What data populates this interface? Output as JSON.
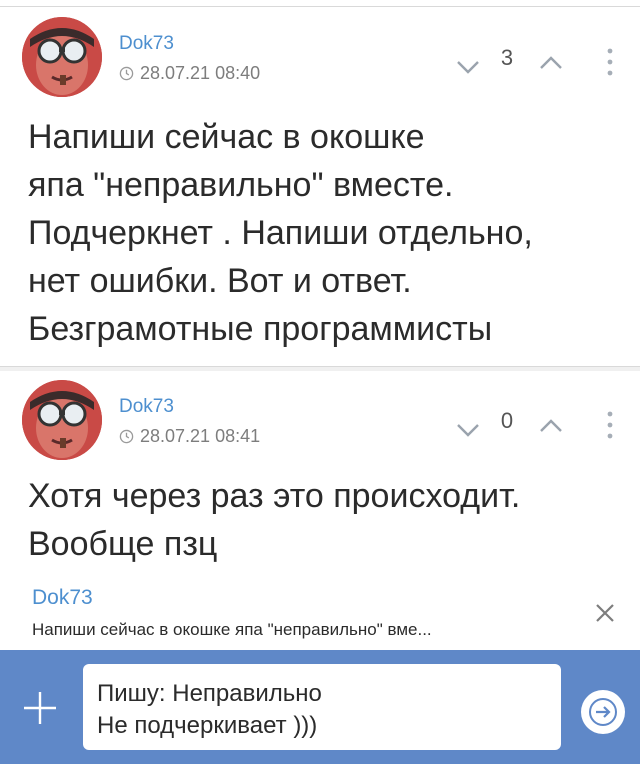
{
  "comments": [
    {
      "author": "Dok73",
      "timestamp": "28.07.21 08:40",
      "score": "3",
      "text": "Напиши сейчас в окошке\nяпа \"неправильно\" вместе.\nПодчеркнет . Напиши отдельно,\nнет ошибки. Вот и ответ.\nБезграмотные программисты"
    },
    {
      "author": "Dok73",
      "timestamp": "28.07.21 08:41",
      "score": "0",
      "text": "Хотя через раз это происходит.\nВообще пзц"
    }
  ],
  "reply_preview": {
    "author": "Dok73",
    "snippet": "Напиши сейчас в окошке япа \"неправильно\" вме..."
  },
  "composer": {
    "line1": "Пишу: Неправильно",
    "line2": "Не подчеркивает )))"
  },
  "colors": {
    "accent": "#4d8fcf",
    "composer_bar": "#5f88c8",
    "text": "#2b2b2b",
    "muted": "#7d7d7d"
  },
  "icons": {
    "vote_down": "chevron-down-icon",
    "vote_up": "chevron-up-icon",
    "more": "more-vertical-icon",
    "clock": "clock-icon",
    "close": "close-icon",
    "attach": "plus-icon",
    "send": "arrow-right-icon"
  }
}
